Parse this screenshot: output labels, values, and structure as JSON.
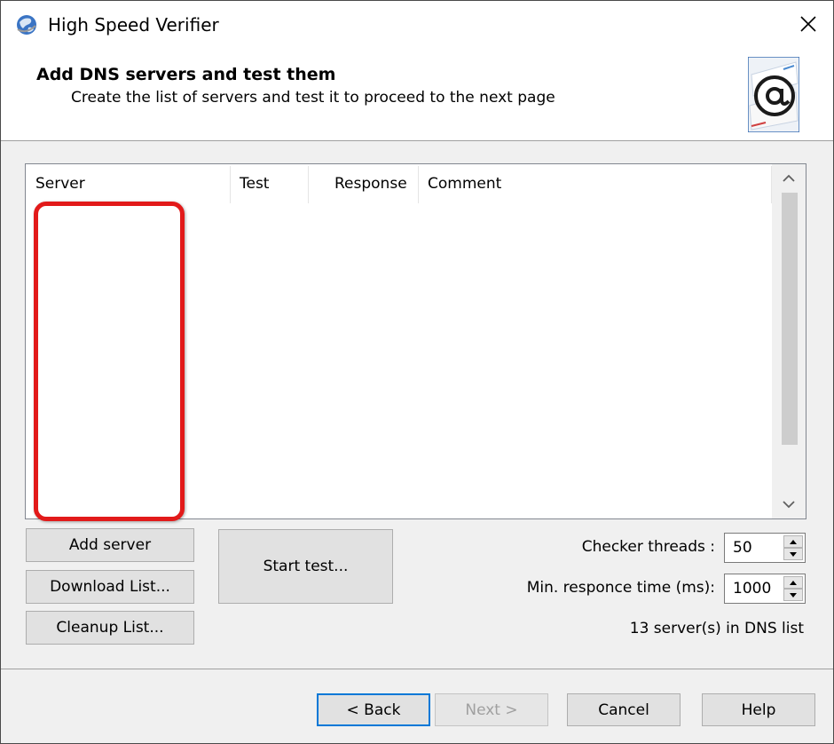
{
  "window": {
    "title": "High Speed Verifier"
  },
  "header": {
    "title": "Add DNS servers and test them",
    "subtitle": "Create the list of servers and test it to proceed to the next page"
  },
  "list": {
    "columns": [
      "Server",
      "Test",
      "Response",
      "Comment"
    ],
    "rows": []
  },
  "buttons": {
    "add_server": "Add server",
    "download_list": "Download List...",
    "cleanup_list": "Cleanup List...",
    "start_test": "Start test..."
  },
  "settings": {
    "threads_label": "Checker threads :",
    "threads_value": "50",
    "min_resp_label": "Min. responce time (ms):",
    "min_resp_value": "1000"
  },
  "status": {
    "server_count_text": "13 server(s) in DNS list"
  },
  "nav": {
    "back": "< Back",
    "next": "Next >",
    "cancel": "Cancel",
    "help": "Help"
  },
  "colors": {
    "highlight": "#e21a1a",
    "primary_border": "#0078d7"
  }
}
